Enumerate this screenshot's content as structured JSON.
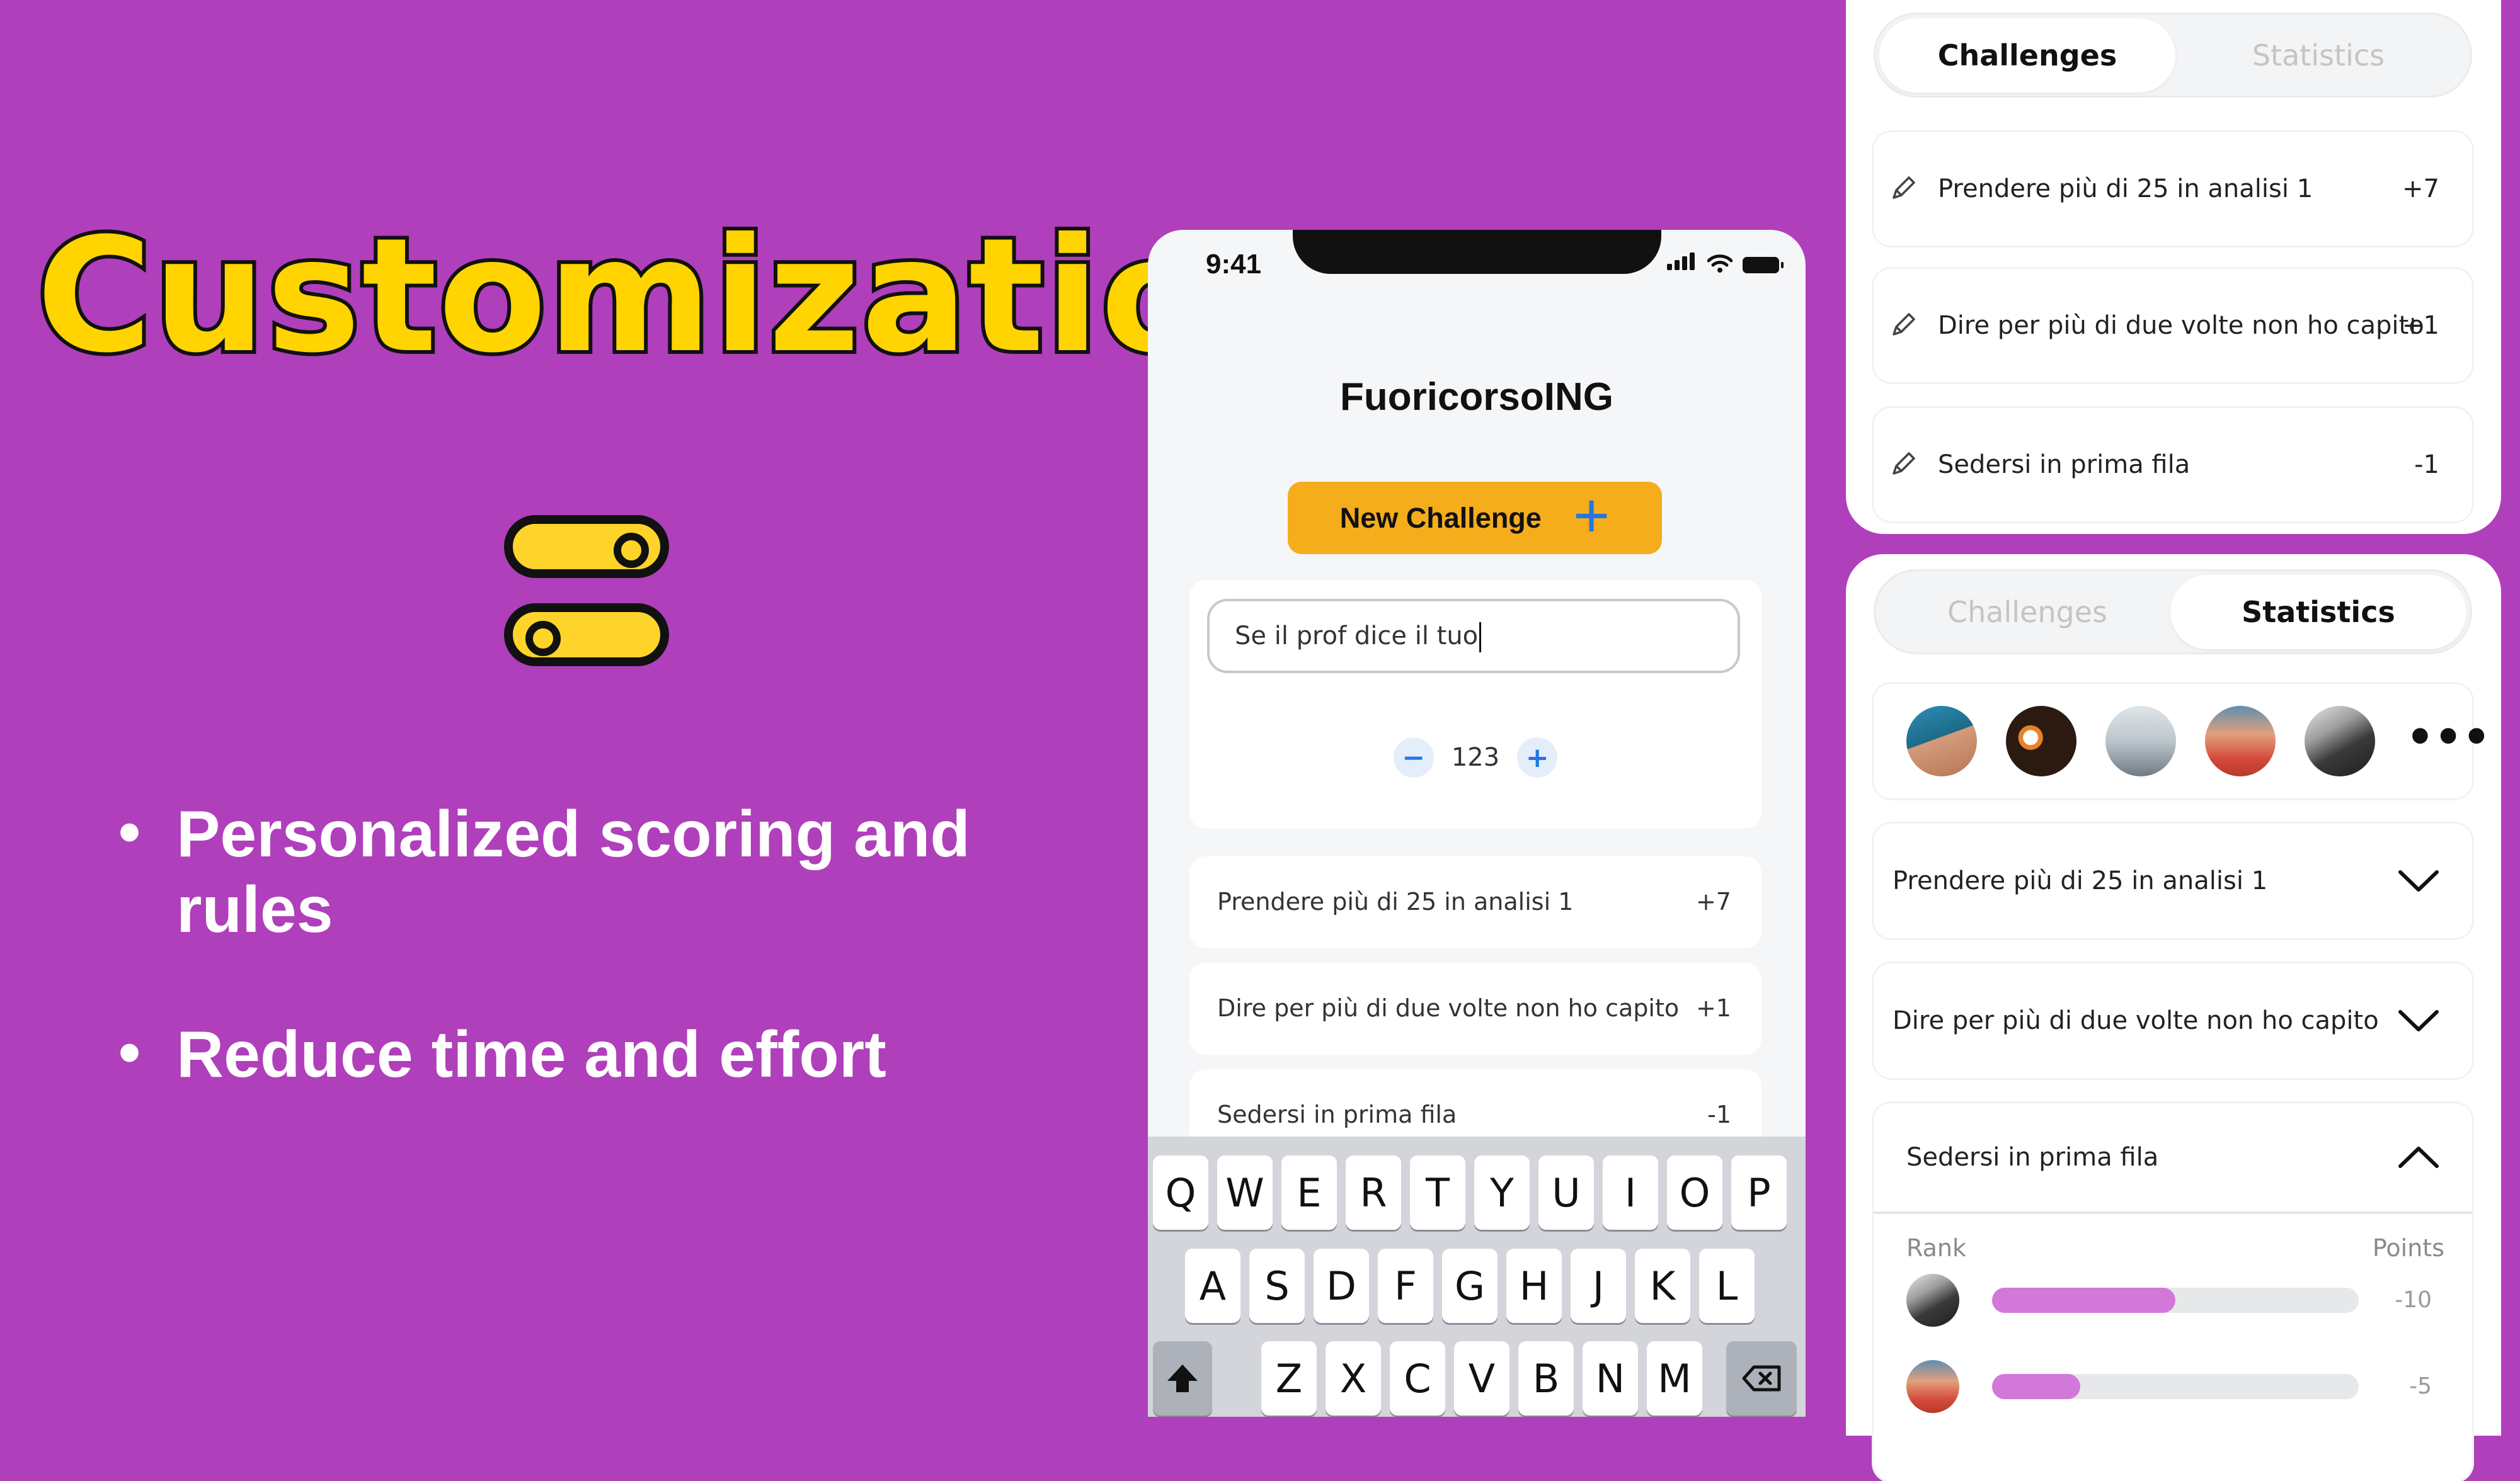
{
  "slide": {
    "title": "Customization",
    "bullets": [
      "Personalized scoring and rules",
      "Reduce time and effort"
    ],
    "colors": {
      "background": "#b03fbb",
      "title": "#ffd400",
      "toggle": "#ffd42a"
    }
  },
  "phone": {
    "status_time": "9:41",
    "app_title": "FuoricorsoING",
    "new_challenge_label": "New Challenge",
    "new_challenge_icon": "plus-icon",
    "text_input_value": "Se il prof dice il tuo",
    "stepper_value": "123",
    "stepper_minus": "−",
    "stepper_plus": "+",
    "challenges": [
      {
        "label": "Prendere più di 25 in analisi 1",
        "points": "+7"
      },
      {
        "label": "Dire per più di due volte non ho capito",
        "points": "+1"
      },
      {
        "label": "Sedersi in prima fila",
        "points": "-1"
      }
    ],
    "keyboard": {
      "row1": [
        "Q",
        "W",
        "E",
        "R",
        "T",
        "Y",
        "U",
        "I",
        "O",
        "P"
      ],
      "row2": [
        "A",
        "S",
        "D",
        "F",
        "G",
        "H",
        "J",
        "K",
        "L"
      ],
      "row3": [
        "Z",
        "X",
        "C",
        "V",
        "B",
        "N",
        "M"
      ]
    },
    "colors": {
      "button": "#f5ad1c",
      "accent": "#2277e6"
    }
  },
  "panel_top": {
    "tabs": {
      "challenges": "Challenges",
      "statistics": "Statistics"
    },
    "active_tab": "Challenges",
    "items": [
      {
        "label": "Prendere più di 25 in analisi 1",
        "points": "+7"
      },
      {
        "label": "Dire per più di due volte non ho capito",
        "points": "+1"
      },
      {
        "label": "Sedersi in prima fila",
        "points": "-1"
      }
    ]
  },
  "panel_bottom": {
    "tabs": {
      "challenges": "Challenges",
      "statistics": "Statistics"
    },
    "active_tab": "Statistics",
    "more_label": "•••",
    "accordion": [
      {
        "label": "Prendere più di 25 in analisi 1",
        "expanded": false
      },
      {
        "label": "Dire per più di due volte non ho capito",
        "expanded": false
      },
      {
        "label": "Sedersi in prima fila",
        "expanded": true
      }
    ],
    "rank_header": "Rank",
    "points_header": "Points",
    "ranking": [
      {
        "value": "-10",
        "fraction": 0.5
      },
      {
        "value": "-5",
        "fraction": 0.24
      }
    ],
    "colors": {
      "bar": "#d178d8"
    }
  }
}
